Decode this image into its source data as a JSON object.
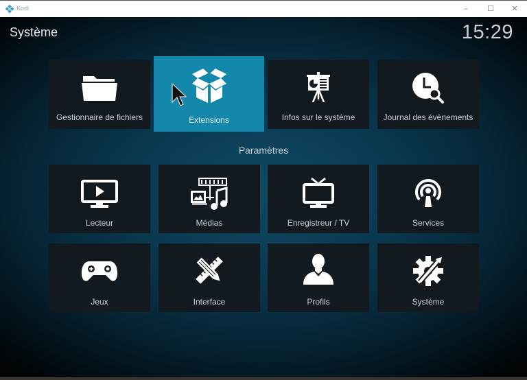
{
  "window": {
    "app_title": "Kodi",
    "controls": {
      "minimize": "–",
      "maximize": "☐",
      "close": "✕"
    }
  },
  "header": {
    "title": "Système",
    "clock": "15:29"
  },
  "top_row": [
    {
      "label": "Gestionnaire de fichiers",
      "icon": "folder-icon",
      "focused": false
    },
    {
      "label": "Extensions",
      "icon": "open-box-icon",
      "focused": true
    },
    {
      "label": "Infos sur le système",
      "icon": "presentation-board-icon",
      "focused": false
    },
    {
      "label": "Journal des évènements",
      "icon": "clock-search-icon",
      "focused": false
    }
  ],
  "settings": {
    "section_title": "Paramètres",
    "items": [
      {
        "label": "Lecteur",
        "icon": "monitor-play-icon"
      },
      {
        "label": "Médias",
        "icon": "media-library-icon"
      },
      {
        "label": "Enregistreur / TV",
        "icon": "tv-antenna-icon"
      },
      {
        "label": "Services",
        "icon": "broadcast-icon"
      },
      {
        "label": "Jeux",
        "icon": "gamepad-icon"
      },
      {
        "label": "Interface",
        "icon": "pencil-ruler-icon"
      },
      {
        "label": "Profils",
        "icon": "user-profile-icon"
      },
      {
        "label": "Système",
        "icon": "gear-wrench-icon"
      }
    ]
  },
  "colors": {
    "focus_accent": "#1488ab",
    "tile_background": "#121a1f",
    "text": "#c9d2d8"
  }
}
